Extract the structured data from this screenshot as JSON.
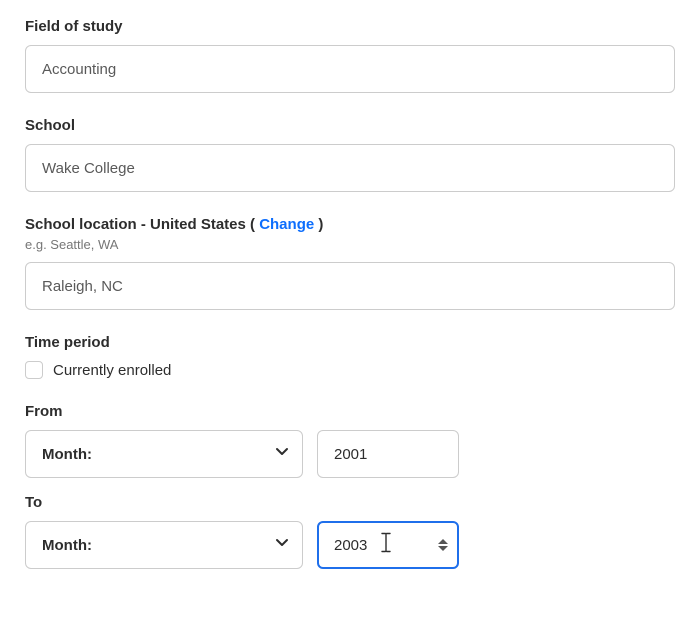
{
  "fieldOfStudy": {
    "label": "Field of study",
    "value": "Accounting"
  },
  "school": {
    "label": "School",
    "value": "Wake College"
  },
  "location": {
    "labelPrefix": "School location - United States ( ",
    "changeText": "Change",
    "labelSuffix": " )",
    "hint": "e.g. Seattle, WA",
    "value": "Raleigh, NC"
  },
  "timePeriod": {
    "label": "Time period",
    "checkboxLabel": "Currently enrolled"
  },
  "from": {
    "label": "From",
    "monthLabel": "Month:",
    "yearValue": "2001"
  },
  "to": {
    "label": "To",
    "monthLabel": "Month:",
    "yearValue": "2003"
  }
}
